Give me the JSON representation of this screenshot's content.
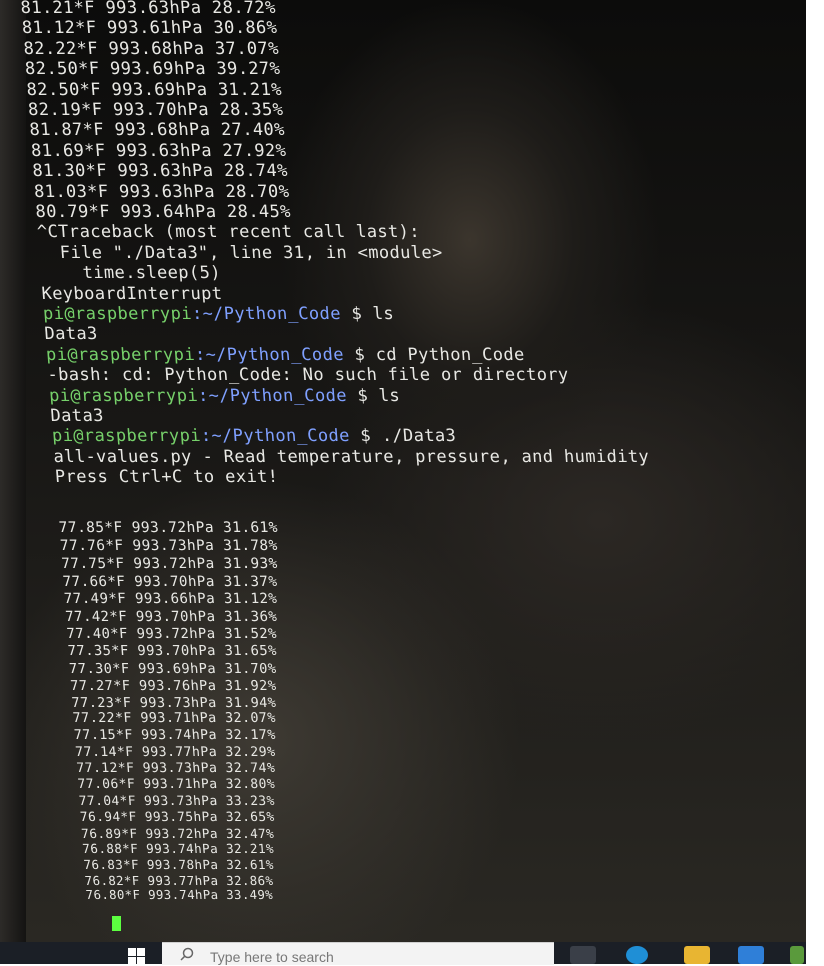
{
  "terminal": {
    "lines": [
      "81.21*F 993.63hPa 28.72%",
      "81.12*F 993.61hPa 30.86%",
      "82.22*F 993.68hPa 37.07%",
      "82.50*F 993.69hPa 39.27%",
      "82.50*F 993.69hPa 31.21%",
      "82.19*F 993.70hPa 28.35%",
      "81.87*F 993.68hPa 27.40%",
      "81.69*F 993.63hPa 27.92%",
      "81.30*F 993.63hPa 28.74%",
      "81.03*F 993.63hPa 28.70%",
      "80.79*F 993.64hPa 28.45%",
      "^CTraceback (most recent call last):",
      "  File \"./Data3\", line 31, in <module>",
      "    time.sleep(5)",
      "KeyboardInterrupt",
      "",
      "Data3",
      "",
      "-bash: cd: Python_Code: No such file or directory",
      "",
      "Data3",
      "",
      "all-values.py - Read temperature, pressure, and humidity",
      "Press Ctrl+C to exit!",
      "",
      "77.85*F 993.72hPa 31.61%",
      "77.76*F 993.73hPa 31.78%",
      "77.75*F 993.72hPa 31.93%",
      "77.66*F 993.70hPa 31.37%",
      "77.49*F 993.66hPa 31.12%",
      "77.42*F 993.70hPa 31.36%",
      "77.40*F 993.72hPa 31.52%",
      "77.35*F 993.70hPa 31.65%",
      "77.30*F 993.69hPa 31.70%",
      "77.27*F 993.76hPa 31.92%",
      "77.23*F 993.73hPa 31.94%",
      "77.22*F 993.71hPa 32.07%",
      "77.15*F 993.74hPa 32.17%",
      "77.14*F 993.77hPa 32.29%",
      "77.12*F 993.73hPa 32.74%",
      "77.06*F 993.71hPa 32.80%",
      "77.04*F 993.73hPa 33.23%",
      "76.94*F 993.75hPa 32.65%",
      "76.89*F 993.72hPa 32.47%",
      "76.88*F 993.74hPa 32.21%",
      "76.83*F 993.78hPa 32.61%",
      "76.82*F 993.77hPa 32.86%",
      "76.80*F 993.74hPa 33.49%"
    ],
    "prompts": [
      {
        "user": "pi@raspberrypi",
        "path": ":~/Python_Code",
        "cmd": " $ ls"
      },
      {
        "user": "pi@raspberrypi",
        "path": ":~/Python_Code",
        "cmd": " $ cd Python_Code"
      },
      {
        "user": "pi@raspberrypi",
        "path": ":~/Python_Code",
        "cmd": " $ ls"
      },
      {
        "user": "pi@raspberrypi",
        "path": ":~/Python_Code",
        "cmd": " $ ./Data3"
      }
    ]
  },
  "taskbar": {
    "search_placeholder": "Type here to search"
  },
  "colors": {
    "prompt_user": "#76d06a",
    "prompt_path": "#7fa0ff",
    "text": "#e8e8e4",
    "cursor": "#5cff40"
  }
}
